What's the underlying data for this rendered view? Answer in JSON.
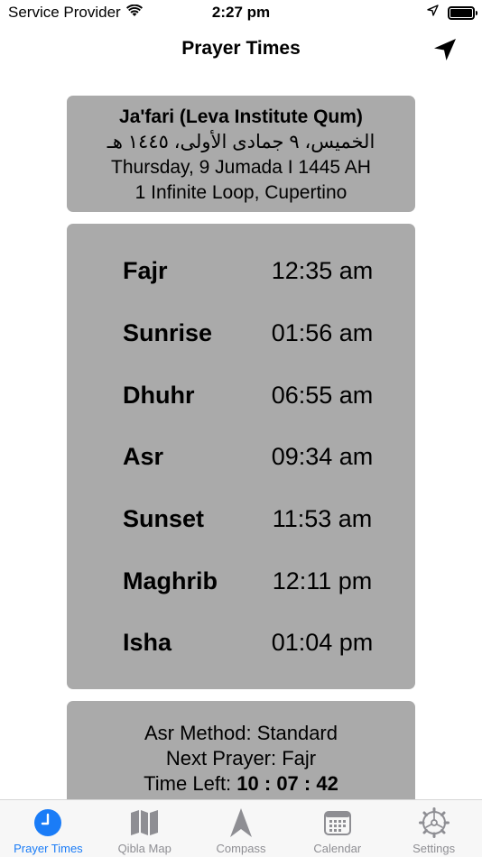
{
  "status_bar": {
    "carrier": "Service Provider",
    "time": "2:27 pm"
  },
  "nav": {
    "title": "Prayer Times",
    "location_icon": "location-arrow-icon"
  },
  "header": {
    "method": "Ja'fari (Leva Institute Qum)",
    "hijri_arabic": "الخميس، ٩ جمادى الأولى، ١٤٤٥ هـ",
    "hijri_english": "Thursday, 9 Jumada I 1445 AH",
    "location": "1 Infinite Loop, Cupertino"
  },
  "prayers": [
    {
      "name": "Fajr",
      "time": "12:35 am"
    },
    {
      "name": "Sunrise",
      "time": "01:56 am"
    },
    {
      "name": "Dhuhr",
      "time": "06:55 am"
    },
    {
      "name": "Asr",
      "time": "09:34 am"
    },
    {
      "name": "Sunset",
      "time": "11:53 am"
    },
    {
      "name": "Maghrib",
      "time": "12:11 pm"
    },
    {
      "name": "Isha",
      "time": "01:04 pm"
    }
  ],
  "info": {
    "asr_method": "Asr Method: Standard",
    "next_prayer": "Next Prayer: Fajr",
    "time_left_label": "Time Left:",
    "time_left_value": "10 : 07 : 42"
  },
  "tabs": [
    {
      "label": "Prayer Times",
      "icon": "clock-icon",
      "active": true
    },
    {
      "label": "Qibla Map",
      "icon": "map-icon",
      "active": false
    },
    {
      "label": "Compass",
      "icon": "compass-arrow-icon",
      "active": false
    },
    {
      "label": "Calendar",
      "icon": "calendar-icon",
      "active": false
    },
    {
      "label": "Settings",
      "icon": "gear-icon",
      "active": false
    }
  ],
  "colors": {
    "accent": "#1a7cf7",
    "card_bg": "#aaaaaa",
    "tab_inactive": "#8e8e93"
  }
}
